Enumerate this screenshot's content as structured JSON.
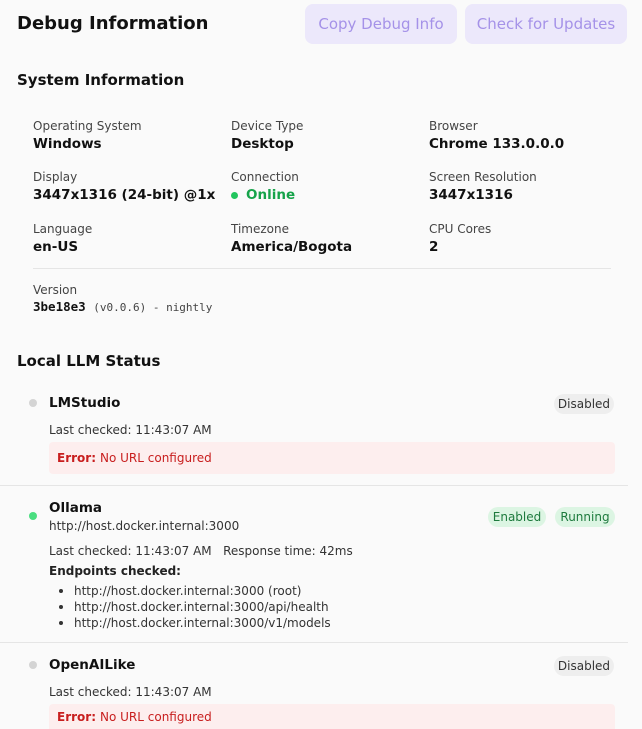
{
  "header": {
    "title": "Debug Information",
    "copy_label": "Copy Debug Info",
    "update_label": "Check for Updates"
  },
  "system": {
    "title": "System Information",
    "items": [
      {
        "label": "Operating System",
        "value": "Windows"
      },
      {
        "label": "Device Type",
        "value": "Desktop"
      },
      {
        "label": "Browser",
        "value": "Chrome 133.0.0.0"
      },
      {
        "label": "Display",
        "value": "3447x1316 (24-bit) @1x"
      },
      {
        "label": "Connection",
        "value": "Online"
      },
      {
        "label": "Screen Resolution",
        "value": "3447x1316"
      },
      {
        "label": "Language",
        "value": "en-US"
      },
      {
        "label": "Timezone",
        "value": "America/Bogota"
      },
      {
        "label": "CPU Cores",
        "value": "2"
      }
    ],
    "version": {
      "label": "Version",
      "hash": "3be18e3",
      "detail": "(v0.0.6) - nightly"
    }
  },
  "llm": {
    "title": "Local LLM Status",
    "providers": [
      {
        "name": "LMStudio",
        "status": "Disabled",
        "last_checked": "Last checked: 11:43:07 AM",
        "error_label": "Error:",
        "error_text": "No URL configured"
      },
      {
        "name": "Ollama",
        "url": "http://host.docker.internal:3000",
        "badge_enabled": "Enabled",
        "badge_running": "Running",
        "last_checked": "Last checked: 11:43:07 AM",
        "response_time": "Response time: 42ms",
        "endpoints_title": "Endpoints checked:",
        "endpoints": [
          "http://host.docker.internal:3000 (root)",
          "http://host.docker.internal:3000/api/health",
          "http://host.docker.internal:3000/v1/models"
        ]
      },
      {
        "name": "OpenAILike",
        "status": "Disabled",
        "last_checked": "Last checked: 11:43:07 AM",
        "error_label": "Error:",
        "error_text": "No URL configured"
      }
    ]
  },
  "colors": {
    "accent_button_bg": "#ece8fb",
    "accent_button_text": "#a592e8",
    "online": "#16a34a",
    "error_bg": "#fdeeee",
    "error_text": "#c81e1e",
    "badge_green_bg": "#dcf5e3"
  }
}
